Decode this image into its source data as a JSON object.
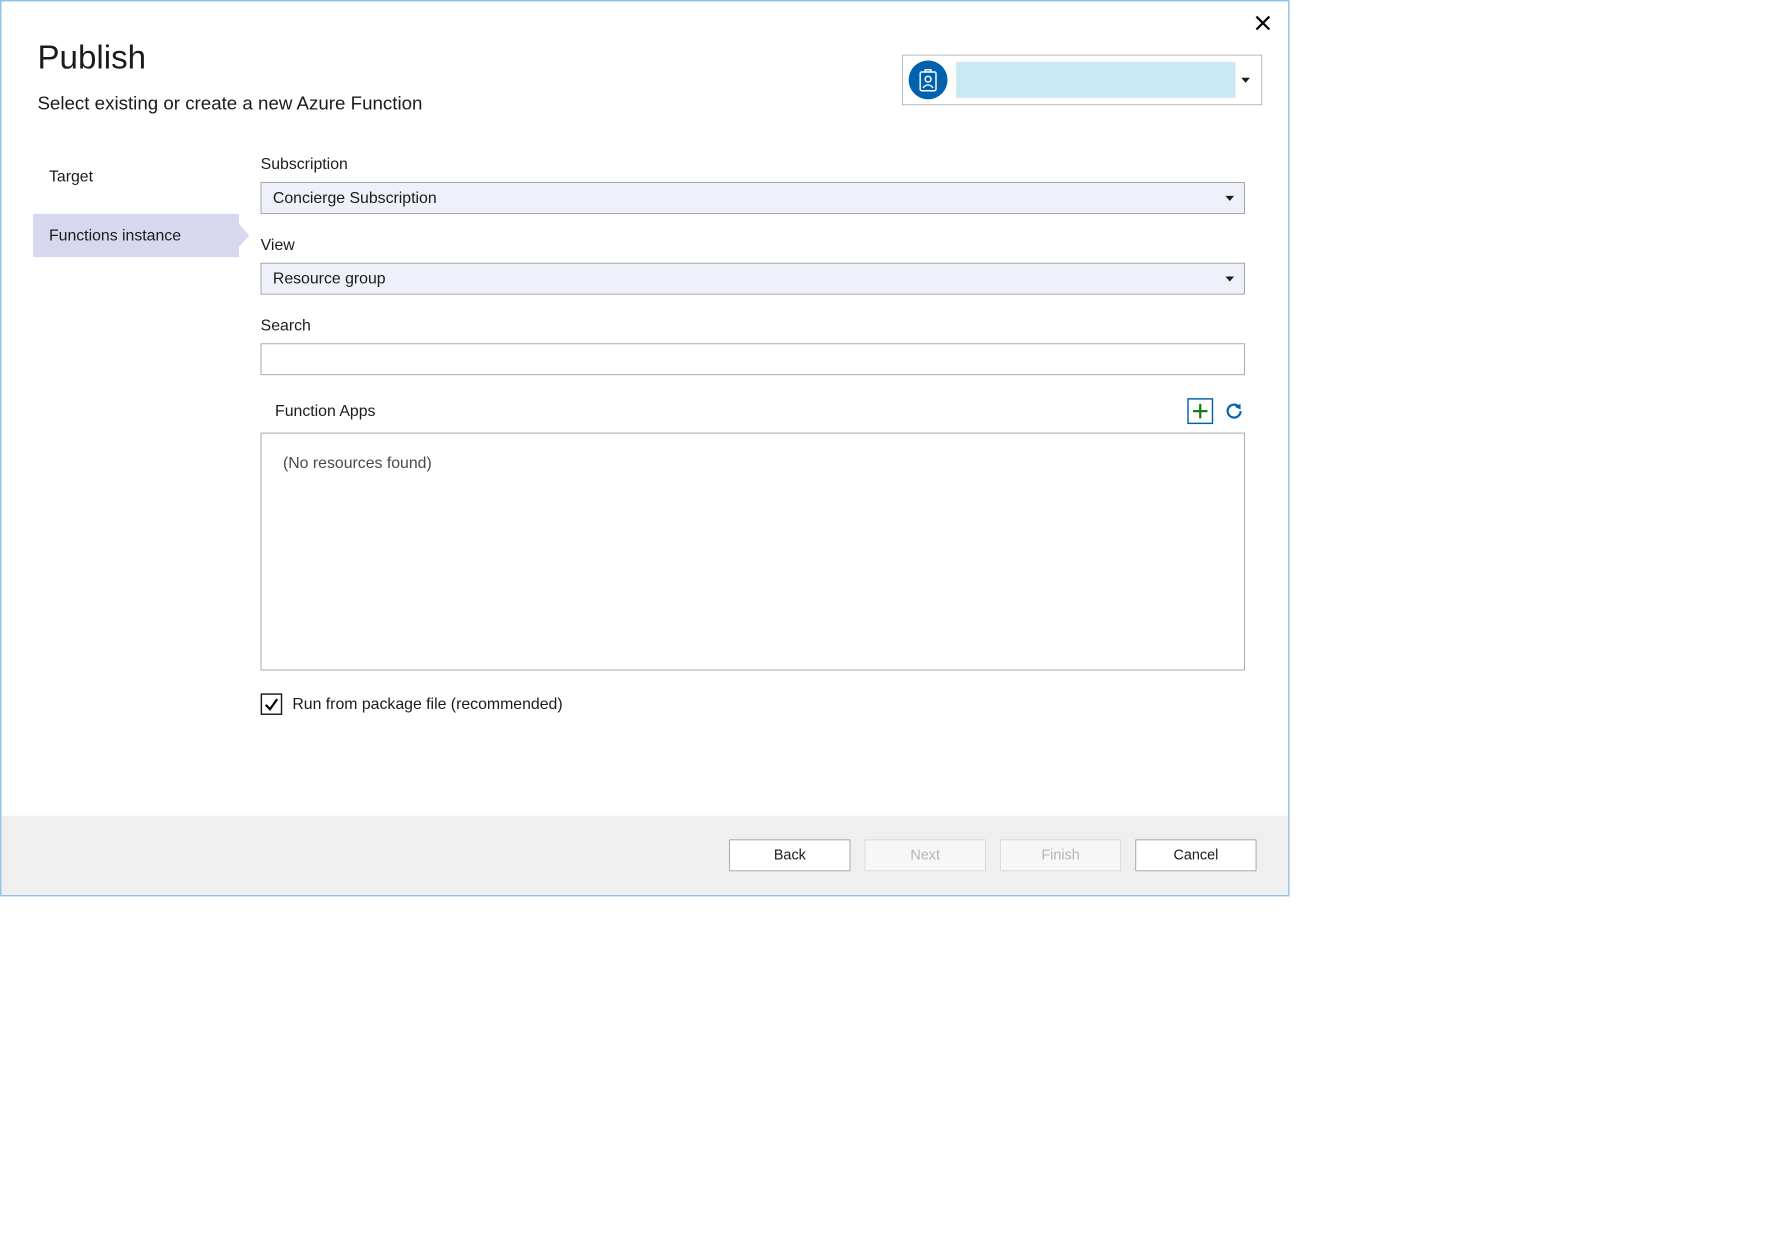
{
  "header": {
    "title": "Publish",
    "subtitle": "Select existing or create a new Azure Function"
  },
  "sidebar": {
    "items": [
      {
        "label": "Target",
        "selected": false
      },
      {
        "label": "Functions instance",
        "selected": true
      }
    ]
  },
  "form": {
    "subscription": {
      "label": "Subscription",
      "value": "Concierge Subscription"
    },
    "view": {
      "label": "View",
      "value": "Resource group"
    },
    "search": {
      "label": "Search",
      "value": ""
    },
    "function_apps": {
      "label": "Function Apps",
      "empty_text": "(No resources found)"
    },
    "run_from_package": {
      "label": "Run from package file (recommended)",
      "checked": true
    }
  },
  "footer": {
    "back": "Back",
    "next": "Next",
    "finish": "Finish",
    "cancel": "Cancel"
  },
  "icons": {
    "close": "close-icon",
    "account_badge": "badge-icon",
    "chevron_down": "chevron-down-icon",
    "add": "plus-icon",
    "refresh": "refresh-icon",
    "check": "check-icon"
  }
}
